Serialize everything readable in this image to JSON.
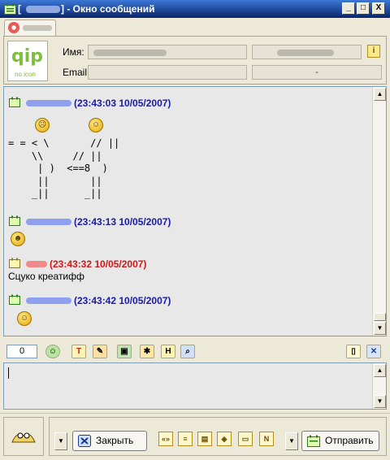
{
  "titlebar": {
    "open_bracket": "[",
    "title_rest": "] - Окно сообщений",
    "minimize": "_",
    "maximize": "□",
    "close": "X"
  },
  "contact": {
    "name_label": "Имя:",
    "email_label": "Email:",
    "email_value": "-",
    "logo_text": "qip",
    "logo_subtext": "no icon"
  },
  "messages": [
    {
      "timestamp": "(23:43:03 10/05/2007)",
      "color": "#1a1aa6"
    },
    {
      "timestamp": "(23:43:13 10/05/2007)",
      "color": "#1a1aa6"
    },
    {
      "timestamp": "(23:43:32 10/05/2007)",
      "color": "#d01818",
      "text": "Сцуко креатифф"
    },
    {
      "timestamp": "(23:43:42 10/05/2007)",
      "color": "#1a1aa6"
    }
  ],
  "ascii_art": "= = < \\       // ||\n    \\\\     // ||\n     | )  <==8  )\n     ||       ||\n    _||      _||",
  "toolbar": {
    "counter": "0",
    "font_btn": "T",
    "history_btn": "H"
  },
  "buttons": {
    "close": "Закрыть",
    "send": "Отправить"
  },
  "smiles_bar": [
    "«»",
    "≡",
    "▤",
    "◈",
    "▭",
    "N"
  ],
  "colors": {
    "titlebar": "#0a246a",
    "own_nick": "#1a1aa6",
    "peer_nick": "#d01818"
  }
}
